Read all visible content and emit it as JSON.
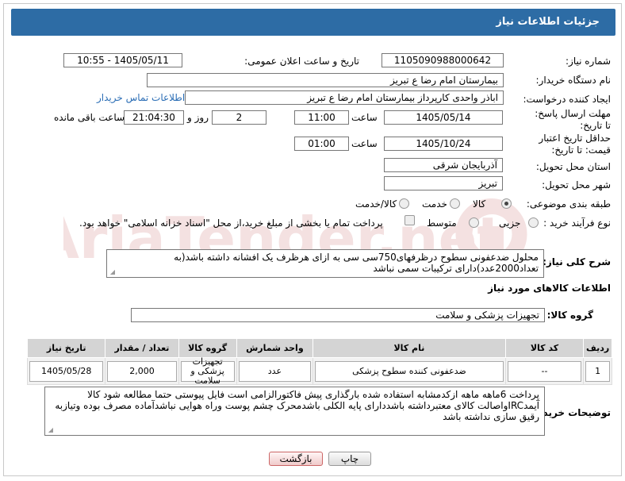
{
  "header": {
    "title": "جزئیات اطلاعات نیاز"
  },
  "fields": {
    "need_number_label": "شماره نیاز:",
    "need_number": "1105090988000642",
    "announce_label": "تاریخ و ساعت اعلان عمومی:",
    "announce_value": "1405/05/11 - 10:55",
    "buyer_org_label": "نام دستگاه خریدار:",
    "buyer_org": "بیمارستان امام رضا  ع  تبریز",
    "creator_label": "ایجاد کننده درخواست:",
    "creator": "اباذر واحدی کارپرداز بیمارستان امام رضا  ع  تبریز",
    "contact_link": "اطلاعات تماس خریدار",
    "reply_deadline_label": "مهلت ارسال پاسخ: تا تاریخ:",
    "reply_date": "1405/05/14",
    "time_label": "ساعت",
    "reply_time": "11:00",
    "days_value": "2",
    "days_label": "روز و",
    "remaining_time": "21:04:30",
    "remaining_label": "ساعت باقی مانده",
    "price_validity_label": "حداقل تاریخ اعتبار قیمت: تا تاریخ:",
    "price_date": "1405/10/24",
    "price_time_label": "ساعت",
    "price_time": "01:00",
    "province_label": "استان محل تحویل:",
    "province": "آذربایجان شرقی",
    "city_label": "شهر محل تحویل:",
    "city": "تبریز",
    "category_label": "طبقه بندی موضوعی:",
    "category_options": [
      "کالا",
      "خدمت",
      "کالا/خدمت"
    ],
    "process_label": "نوع فرآیند خرید :",
    "process_options": [
      "جزیی",
      "متوسط"
    ],
    "payment_note": "پرداخت تمام یا بخشی از مبلغ خرید،از محل \"اسناد خزانه اسلامی\" خواهد بود.",
    "description_label": "شرح کلی نیاز:",
    "description": "محلول ضدعفونی سطوح درظرفهای750سی سی به ازای هرظرف یک افشانه داشته باشد(به تعداد2000عدد)دارای ترکیبات سمی نباشد",
    "goods_info_title": "اطلاعات کالاهای مورد نیاز",
    "goods_group_label": "گروه کالا:",
    "goods_group": "تجهیزات پزشکی و سلامت",
    "buyer_notes_label": "توضیحات خریدار:",
    "buyer_notes": "پرداخت 6ماهه ماهه ازکدمشابه استفاده شده بارگذاری پیش فاکتورالزامی است فایل پیوستی حتما مطالعه شود کالا آیمدIRCواصالت کالای معتبرداشته باشددارای پایه الکلی باشدمحرک چشم پوست وراه هوایی نباشدآماده مصرف بوده وتیازبه رقیق سازی نداشته باشد"
  },
  "table": {
    "headers": [
      "ردیف",
      "کد کالا",
      "نام کالا",
      "واحد شمارش",
      "گروه کالا",
      "تعداد / مقدار",
      "تاریخ نیاز"
    ],
    "rows": [
      [
        "1",
        "--",
        "ضدعفونی کننده سطوح پزشکی",
        "عدد",
        "تجهیزات پزشکی و سلامت",
        "2,000",
        "1405/05/28"
      ]
    ]
  },
  "buttons": {
    "print": "چاپ",
    "back": "بازگشت"
  },
  "watermark": {
    "text": "AriaTender.net"
  }
}
